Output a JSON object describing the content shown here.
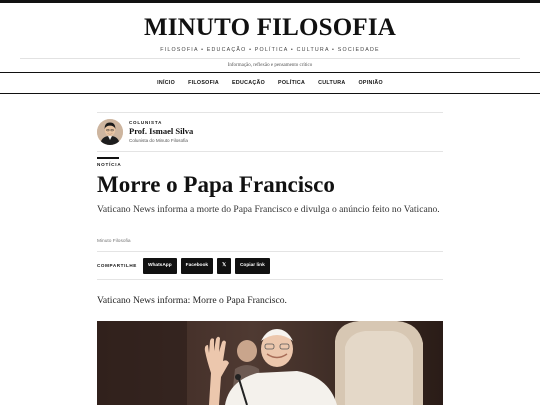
{
  "site": {
    "title": "MINUTO FILOSOFIA",
    "sections": "FILOSOFIA • EDUCAÇÃO • POLÍTICA • CULTURA • SOCIEDADE",
    "tagline": "Informação, reflexão e pensamento crítico"
  },
  "nav": {
    "items": [
      "INÍCIO",
      "FILOSOFIA",
      "EDUCAÇÃO",
      "POLÍTICA",
      "CULTURA",
      "OPINIÃO"
    ]
  },
  "author": {
    "kicker": "COLUNISTA",
    "name": "Prof. Ismael Silva",
    "role": "Colunista do Minuto Filosofia"
  },
  "article": {
    "kicker": "NOTÍCIA",
    "headline": "Morre o Papa Francisco",
    "dek": "Vaticano News informa a morte do Papa Francisco e divulga o anúncio feito no Vaticano.",
    "source": "Minuto Filosofia",
    "lead": "Vaticano News informa: Morre o Papa Francisco."
  },
  "share": {
    "label": "COMPARTILHE",
    "buttons": [
      "WhatsApp",
      "Facebook",
      "𝕏",
      "Copiar link"
    ]
  },
  "colors": {
    "ink": "#111111",
    "muted": "#555555",
    "rule": "#e4e4e4"
  }
}
